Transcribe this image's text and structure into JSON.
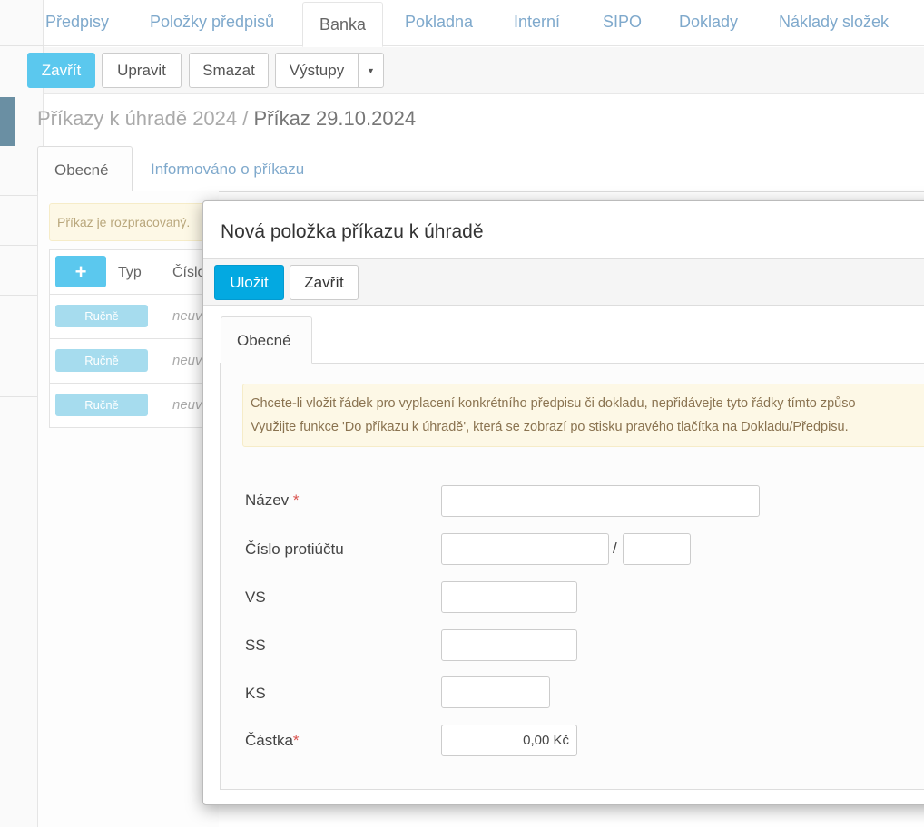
{
  "top_tabs": [
    "Předpisy",
    "Položky předpisů",
    "Banka",
    "Pokladna",
    "Interní",
    "SIPO",
    "Doklady",
    "Náklady složek"
  ],
  "toolbar": {
    "close": "Zavřít",
    "edit": "Upravit",
    "delete": "Smazat",
    "outputs": "Výstupy"
  },
  "breadcrumb": {
    "parent": "Příkazy k úhradě 2024",
    "separator": " / ",
    "current": "Příkaz 29.10.2024"
  },
  "sub_tabs": [
    "Obecné",
    "Informováno o příkazu"
  ],
  "status_warning": "Příkaz je rozpracovaný.",
  "table": {
    "add": "+",
    "columns": [
      "Typ",
      "Číslo"
    ],
    "rows": [
      {
        "type": "Ručně",
        "value": "neuv"
      },
      {
        "type": "Ručně",
        "value": "neuv"
      },
      {
        "type": "Ručně",
        "value": "neuv"
      }
    ]
  },
  "modal": {
    "title": "Nová položka příkazu k úhradě",
    "save": "Uložit",
    "close": "Zavřít",
    "tab": "Obecné",
    "alert_line1": "Chcete-li vložit řádek pro vyplacení konkrétního předpisu či dokladu, nepřidávejte tyto řádky tímto způso",
    "alert_line2": "Využijte funkce 'Do příkazu k úhradě', která se zobrazí po stisku pravého tlačítka na Dokladu/Předpisu.",
    "fields": {
      "name": "Název",
      "account": "Číslo protiúčtu",
      "account_sep": "/",
      "vs": "VS",
      "ss": "SS",
      "ks": "KS",
      "amount": "Částka",
      "required": "*",
      "amount_value": "0,00 Kč"
    }
  }
}
